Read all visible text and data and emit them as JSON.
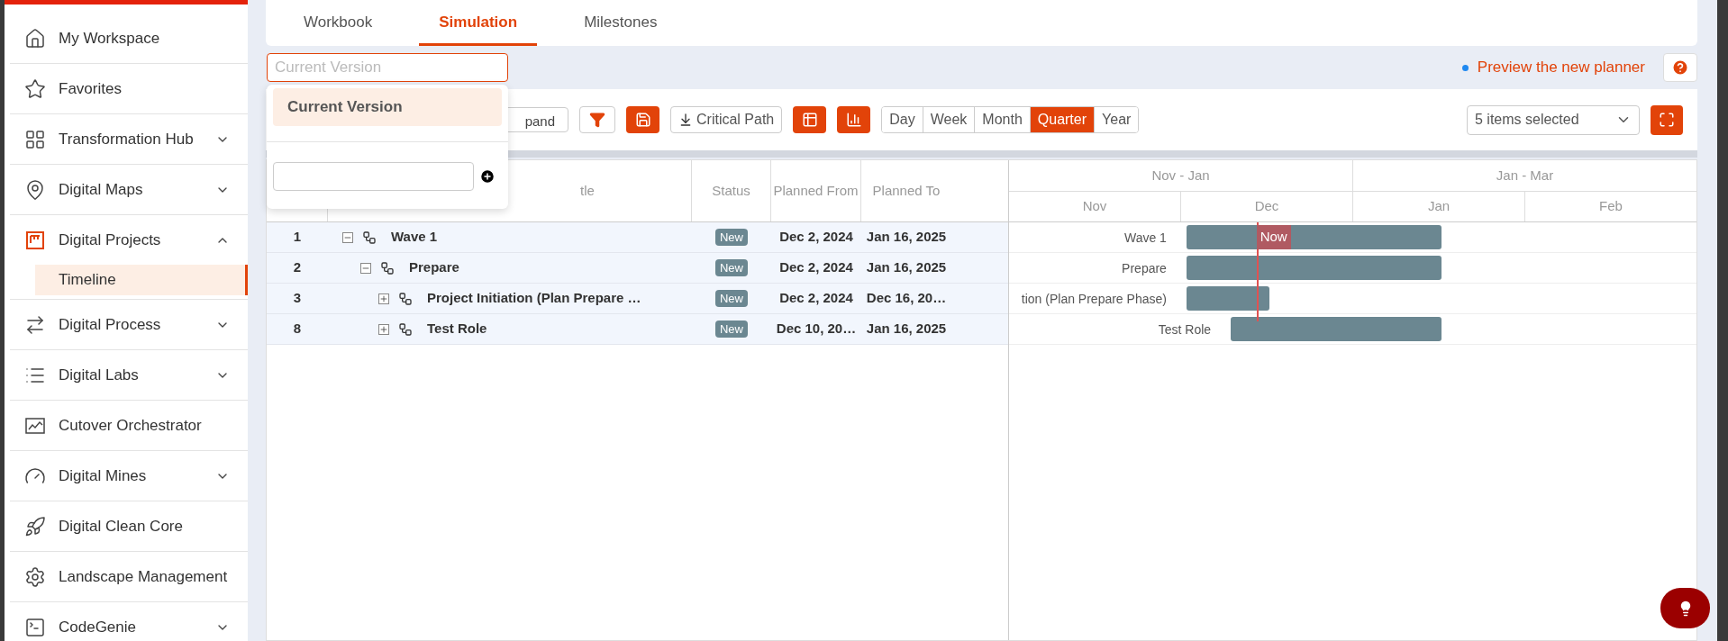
{
  "sidebar": {
    "items": [
      {
        "kind": "link",
        "label": "My Workspace"
      },
      {
        "kind": "link",
        "label": "Favorites"
      },
      {
        "kind": "group",
        "label": "Transformation Hub",
        "expanded": false
      },
      {
        "kind": "group",
        "label": "Digital Maps",
        "expanded": false
      },
      {
        "kind": "group",
        "label": "Digital Projects",
        "expanded": true,
        "children": [
          {
            "label": "Timeline",
            "selected": true
          }
        ]
      },
      {
        "kind": "group",
        "label": "Digital Process",
        "expanded": false
      },
      {
        "kind": "group",
        "label": "Digital Labs",
        "expanded": false
      },
      {
        "kind": "link",
        "label": "Cutover Orchestrator"
      },
      {
        "kind": "group",
        "label": "Digital Mines",
        "expanded": false
      },
      {
        "kind": "link",
        "label": "Digital Clean Core"
      },
      {
        "kind": "link",
        "label": "Landscape Management"
      },
      {
        "kind": "group",
        "label": "CodeGenie",
        "expanded": false
      }
    ]
  },
  "tabs": [
    {
      "label": "Workbook",
      "selected": false
    },
    {
      "label": "Simulation",
      "selected": true
    },
    {
      "label": "Milestones",
      "selected": false
    }
  ],
  "version_field": {
    "placeholder": "Current Version"
  },
  "version_menu": {
    "options": [
      {
        "label": "Current Version",
        "selected": true
      }
    ]
  },
  "preview_link": "Preview the new planner",
  "toolbar": {
    "expand_label": "pand",
    "critical_path": "Critical Path",
    "scales": [
      {
        "label": "Day",
        "selected": false
      },
      {
        "label": "Week",
        "selected": false
      },
      {
        "label": "Month",
        "selected": false
      },
      {
        "label": "Quarter",
        "selected": true
      },
      {
        "label": "Year",
        "selected": false
      }
    ],
    "columns_select": "5 items selected"
  },
  "table": {
    "columns": [
      "",
      "tle",
      "Status",
      "Planned From",
      "Planned To"
    ],
    "rows": [
      {
        "number": "1",
        "title": "Wave 1",
        "status": "New",
        "planned_from": "Dec 2, 2024",
        "planned_to": "Jan 16, 2025",
        "gantt_label": "Wave 1",
        "expanded": true,
        "children": [
          {
            "number": "2",
            "title": "Prepare",
            "status": "New",
            "planned_from": "Dec 2, 2024",
            "planned_to": "Jan 16, 2025",
            "gantt_label": "Prepare",
            "expanded": true,
            "children": [
              {
                "number": "3",
                "title": "Project Initiation (Plan Prepare …",
                "status": "New",
                "planned_from": "Dec 2, 2024",
                "planned_to": "Dec 16, 20…",
                "gantt_label": "tion (Plan Prepare Phase)",
                "expanded": false
              },
              {
                "number": "8",
                "title": "Test Role",
                "status": "New",
                "planned_from": "Dec 10, 20…",
                "planned_to": "Jan 16, 2025",
                "gantt_label": "Test Role",
                "expanded": false
              }
            ]
          }
        ]
      }
    ]
  },
  "timeline": {
    "quarters": [
      "Nov - Jan",
      "Jan - Mar"
    ],
    "months": [
      "Nov",
      "Dec",
      "Jan",
      "Feb"
    ],
    "now": {
      "label": "Now",
      "level": 0.36
    }
  }
}
